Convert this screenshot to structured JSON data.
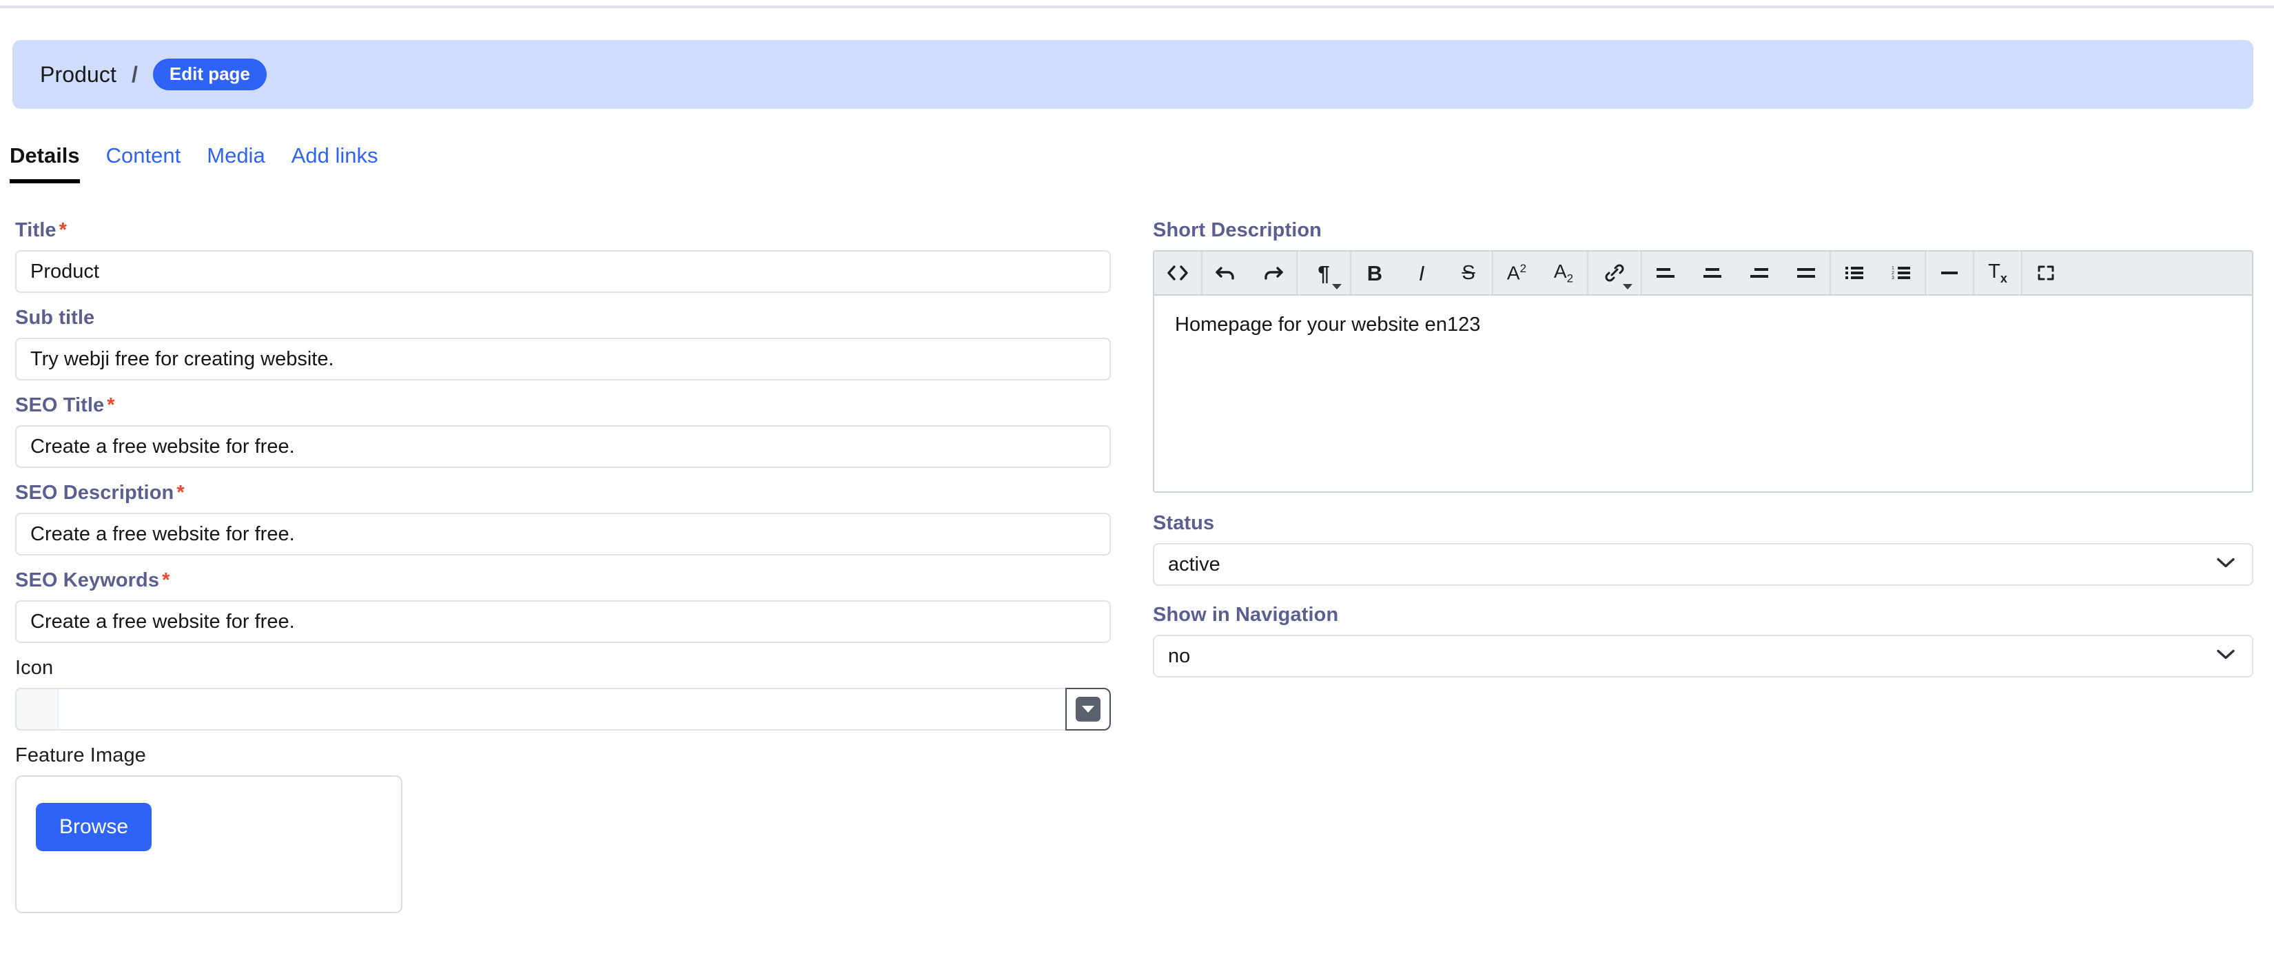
{
  "breadcrumb": {
    "root_label": "Product",
    "separator": "/",
    "current_label": "Edit page"
  },
  "tabs": [
    {
      "label": "Details",
      "active": true
    },
    {
      "label": "Content",
      "active": false
    },
    {
      "label": "Media",
      "active": false
    },
    {
      "label": "Add links",
      "active": false
    }
  ],
  "left_column": {
    "title": {
      "label": "Title",
      "required_marker": "*",
      "value": "Product"
    },
    "sub_title": {
      "label": "Sub title",
      "value": "Try webji free for creating website."
    },
    "seo_title": {
      "label": "SEO Title",
      "required_marker": "*",
      "value": "Create a free website for free."
    },
    "seo_description": {
      "label": "SEO Description",
      "required_marker": "*",
      "value": "Create a free website for free."
    },
    "seo_keywords": {
      "label": "SEO Keywords",
      "required_marker": "*",
      "value": "Create a free website for free."
    },
    "icon": {
      "label": "Icon",
      "value": "",
      "picker_icon": "caret-down-icon"
    },
    "feature_image": {
      "label": "Feature Image",
      "browse_label": "Browse"
    }
  },
  "right_column": {
    "short_description": {
      "label": "Short Description",
      "content": "Homepage for your website en123"
    },
    "editor_toolbar": [
      {
        "name": "source-code-icon",
        "group": 0
      },
      {
        "name": "undo-icon",
        "group": 1
      },
      {
        "name": "redo-icon",
        "group": 1
      },
      {
        "name": "paragraph-format-icon",
        "group": 2,
        "has_caret": true
      },
      {
        "name": "bold-icon",
        "group": 3,
        "glyph": "B"
      },
      {
        "name": "italic-icon",
        "group": 3,
        "glyph": "I"
      },
      {
        "name": "strikethrough-icon",
        "group": 3
      },
      {
        "name": "superscript-icon",
        "group": 4
      },
      {
        "name": "subscript-icon",
        "group": 4
      },
      {
        "name": "insert-link-icon",
        "group": 5,
        "has_caret": true
      },
      {
        "name": "align-left-icon",
        "group": 6
      },
      {
        "name": "align-center-icon",
        "group": 6
      },
      {
        "name": "align-right-icon",
        "group": 6
      },
      {
        "name": "align-justify-icon",
        "group": 6
      },
      {
        "name": "unordered-list-icon",
        "group": 7
      },
      {
        "name": "ordered-list-icon",
        "group": 7
      },
      {
        "name": "horizontal-rule-icon",
        "group": 8
      },
      {
        "name": "clear-formatting-icon",
        "group": 9
      },
      {
        "name": "fullscreen-icon",
        "group": 10
      }
    ],
    "status": {
      "label": "Status",
      "value": "active",
      "options": [
        "active"
      ]
    },
    "show_in_navigation": {
      "label": "Show in Navigation",
      "value": "no",
      "options": [
        "no"
      ]
    }
  },
  "colors": {
    "accent_blue": "#2f63f6",
    "banner_blue": "#cfdcfb",
    "label_purple": "#5a5f8f",
    "required_red": "#e8472d",
    "toolbar_gray": "#e9edf0",
    "border_gray": "#dfe2e8"
  }
}
